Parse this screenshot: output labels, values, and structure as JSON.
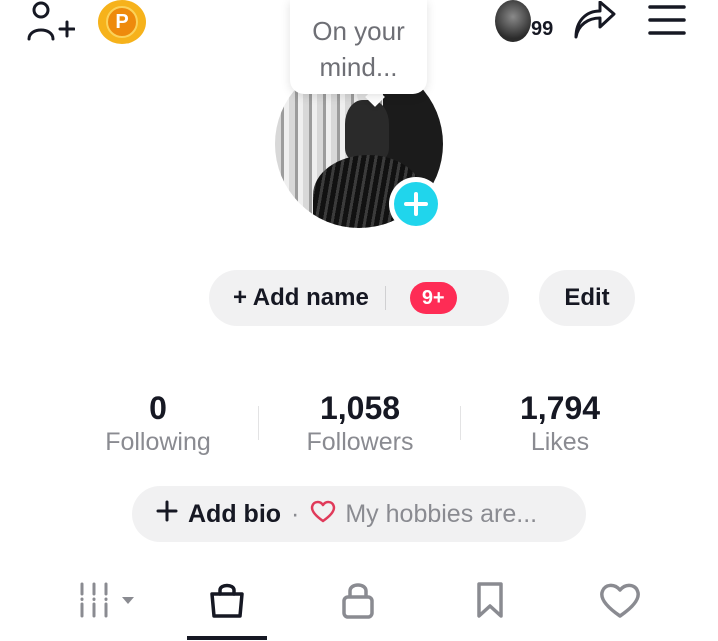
{
  "header": {
    "story_count": "99",
    "coin_letter": "P"
  },
  "bubble": {
    "text_line1": "On your",
    "text_line2": "mind..."
  },
  "profile": {
    "add_name_label": "+ Add name",
    "notification_badge": "9+",
    "edit_label": "Edit"
  },
  "stats": [
    {
      "value": "0",
      "label": "Following"
    },
    {
      "value": "1,058",
      "label": "Followers"
    },
    {
      "value": "1,794",
      "label": "Likes"
    }
  ],
  "bio": {
    "add_bio_label": "Add bio",
    "separator": "·",
    "hobbies_placeholder": "My hobbies are..."
  },
  "tabs": [
    {
      "name": "videos-grid",
      "icon": "grid-icon",
      "active": false
    },
    {
      "name": "shop",
      "icon": "shopping-bag-icon",
      "active": true
    },
    {
      "name": "private",
      "icon": "lock-icon",
      "active": false
    },
    {
      "name": "saved",
      "icon": "bookmark-icon",
      "active": false
    },
    {
      "name": "liked",
      "icon": "heart-icon",
      "active": false
    }
  ],
  "colors": {
    "accent_cyan": "#20d5ec",
    "badge_red": "#fe2c55",
    "coin_orange": "#f6b21b",
    "text_primary": "#161823",
    "text_secondary": "#8a8b91"
  }
}
